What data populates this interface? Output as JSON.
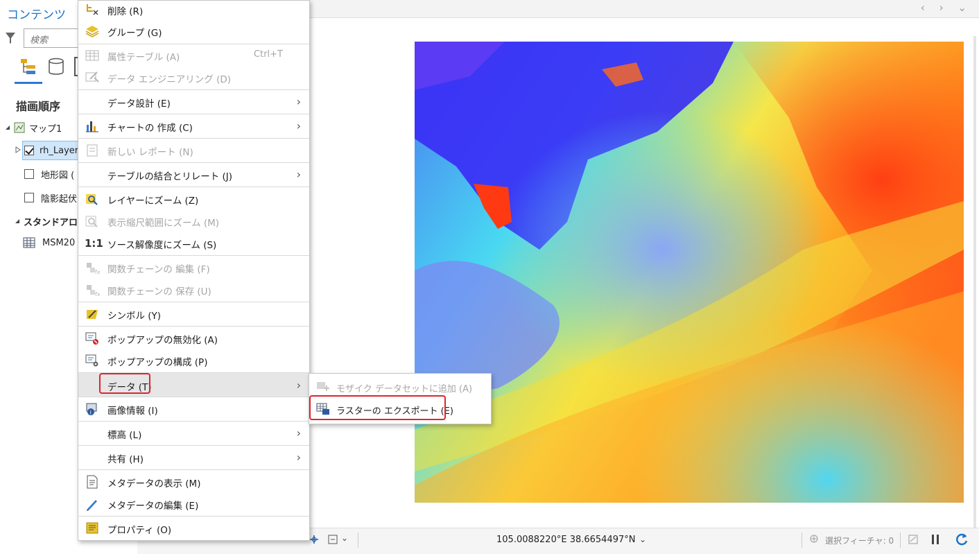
{
  "contents_pane": {
    "title": "コンテンツ",
    "search_placeholder": "検索",
    "heading": "描画順序",
    "tree": {
      "map": "マップ1",
      "layer_rh": "rh_Layer",
      "layer_topo": "地形図 (",
      "layer_hillshade": "陰影起伏",
      "standalone_heading": "スタンドアロン",
      "table_msm": "MSM20"
    }
  },
  "context_menu": {
    "items": [
      {
        "label": "削除 (R)",
        "icon": "delete-icon"
      },
      {
        "label": "グループ (G)",
        "icon": "group-layers-icon"
      },
      {
        "label": "属性テーブル (A)",
        "shortcut": "Ctrl+T",
        "icon": "attribute-table-icon",
        "disabled": true
      },
      {
        "label": "データ エンジニアリング (D)",
        "icon": "data-engineering-icon",
        "disabled": true
      },
      {
        "label": "データ設計 (E)",
        "submenu": true
      },
      {
        "label": "チャートの 作成 (C)",
        "icon": "chart-icon",
        "submenu": true
      },
      {
        "label": "新しい レポート (N)",
        "icon": "report-icon",
        "disabled": true
      },
      {
        "label": "テーブルの結合とリレート (J)",
        "submenu": true
      },
      {
        "label": "レイヤーにズーム (Z)",
        "icon": "zoom-to-layer-icon"
      },
      {
        "label": "表示縮尺範囲にズーム (M)",
        "icon": "zoom-visible-range-icon",
        "disabled": true
      },
      {
        "label": "ソース解像度にズーム (S)",
        "icon": "one-to-one-icon",
        "icon_text": "1:1"
      },
      {
        "label": "関数チェーンの 編集 (F)",
        "icon": "function-chain-edit-icon",
        "disabled": true
      },
      {
        "label": "関数チェーンの 保存 (U)",
        "icon": "function-chain-save-icon",
        "disabled": true
      },
      {
        "label": "シンボル (Y)",
        "icon": "symbology-icon"
      },
      {
        "label": "ポップアップの無効化 (A)",
        "icon": "disable-popup-icon"
      },
      {
        "label": "ポップアップの構成 (P)",
        "icon": "configure-popup-icon"
      },
      {
        "label": "データ (T)",
        "submenu": true,
        "highlighted": true
      },
      {
        "label": "画像情報 (I)",
        "icon": "image-info-icon"
      },
      {
        "label": "標高 (L)",
        "submenu": true
      },
      {
        "label": "共有 (H)",
        "submenu": true
      },
      {
        "label": "メタデータの表示 (M)",
        "icon": "view-metadata-icon"
      },
      {
        "label": "メタデータの編集 (E)",
        "icon": "edit-metadata-icon"
      },
      {
        "label": "プロパティ (O)",
        "icon": "properties-icon"
      }
    ]
  },
  "data_submenu": {
    "items": [
      {
        "label": "モザイク データセットに追加 (A)",
        "icon": "add-to-mosaic-icon",
        "disabled": true
      },
      {
        "label": "ラスターの エクスポート (E)",
        "icon": "export-raster-icon",
        "highlighted": true
      }
    ]
  },
  "status_bar": {
    "coordinates": "105.0088220°E 38.6654497°N",
    "selected_features": "選択フィーチャ: 0"
  },
  "colors": {
    "highlight_border": "#d9262d",
    "accent_blue": "#1a73c9",
    "disabled_text": "#a6a6a6"
  }
}
